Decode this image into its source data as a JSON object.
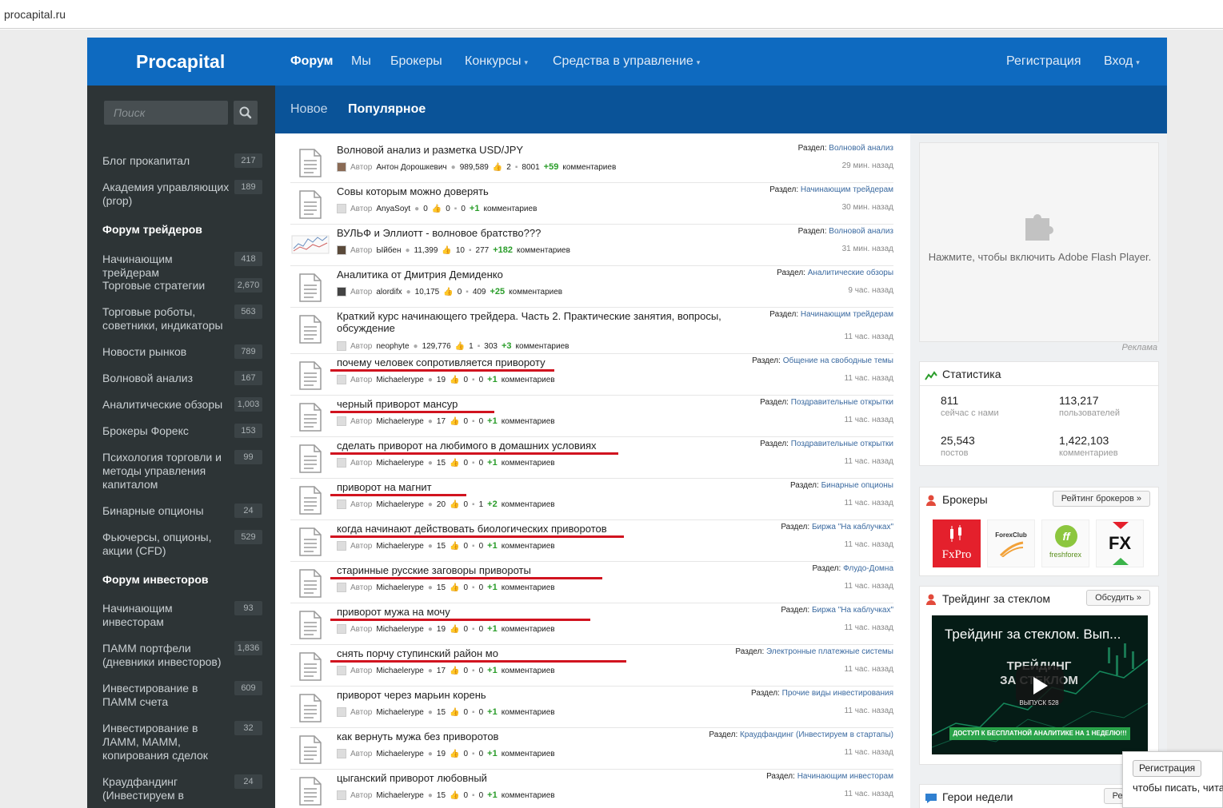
{
  "browser": {
    "url": "procapital.ru"
  },
  "header": {
    "logo": "Procapital",
    "nav": [
      {
        "label": "Форум",
        "active": true
      },
      {
        "label": "Мы"
      },
      {
        "label": "Брокеры"
      },
      {
        "label": "Конкурсы",
        "dropdown": true
      },
      {
        "label": "Средства в управление",
        "dropdown": true
      }
    ],
    "register": "Регистрация",
    "login": "Вход"
  },
  "sidebar": {
    "search_placeholder": "Поиск",
    "items": [
      {
        "label": "Блог прокапитал",
        "count": "217"
      },
      {
        "label": "Академия управляющих (prop)",
        "count": "189"
      },
      {
        "label": "Форум трейдеров",
        "heading": true
      },
      {
        "label": "Начинающим трейдерам",
        "count": "418"
      },
      {
        "label": "Торговые стратегии",
        "count": "2,670"
      },
      {
        "label": "Торговые роботы, советники, индикаторы",
        "count": "563"
      },
      {
        "label": "Новости рынков",
        "count": "789"
      },
      {
        "label": "Волновой анализ",
        "count": "167"
      },
      {
        "label": "Аналитические обзоры",
        "count": "1,003"
      },
      {
        "label": "Брокеры Форекс",
        "count": "153"
      },
      {
        "label": "Психология торговли и методы управления капиталом",
        "count": "99"
      },
      {
        "label": "Бинарные опционы",
        "count": "24"
      },
      {
        "label": "Фьючерсы, опционы, акции (CFD)",
        "count": "529"
      },
      {
        "label": "Форум инвесторов",
        "heading": true
      },
      {
        "label": "Начинающим инвесторам",
        "count": "93"
      },
      {
        "label": "ПАММ портфели (дневники инвесторов)",
        "count": "1,836"
      },
      {
        "label": "Инвестирование в ПАММ счета",
        "count": "609"
      },
      {
        "label": "Инвестирование в ЛАММ, МАММ, копирования сделок",
        "count": "32"
      },
      {
        "label": "Краудфандинг (Инвестируем в",
        "count": "24"
      }
    ]
  },
  "subnav": {
    "new": "Новое",
    "popular": "Популярное"
  },
  "posts": [
    {
      "title": "Волновой анализ и разметка USD/JPY",
      "author_label": "Автор",
      "author": "Антон Дорошкевич",
      "views": "989,589",
      "likes": "2",
      "comments": "8001",
      "plus": "+59",
      "comments_label": "комментариев",
      "section_label": "Раздел:",
      "section": "Волновой анализ",
      "time": "29 мин. назад",
      "thumb": "photo",
      "underline": false
    },
    {
      "title": "Совы которым можно доверять",
      "author_label": "Автор",
      "author": "AnyaSoyt",
      "views": "0",
      "likes": "0",
      "comments": "0",
      "plus": "+1",
      "comments_label": "комментариев",
      "section_label": "Раздел:",
      "section": "Начинающим трейдерам",
      "time": "30 мин. назад",
      "thumb": "doc",
      "underline": false
    },
    {
      "title": "ВУЛЬФ и Эллиотт - волновое братство???",
      "author_label": "Автор",
      "author": "Ыйбен",
      "views": "11,399",
      "likes": "10",
      "comments": "277",
      "plus": "+182",
      "comments_label": "комментариев",
      "section_label": "Раздел:",
      "section": "Волновой анализ",
      "time": "31 мин. назад",
      "thumb": "chart",
      "underline": false
    },
    {
      "title": "Аналитика от Дмитрия Демиденко",
      "author_label": "Автор",
      "author": "alordifx",
      "views": "10,175",
      "likes": "0",
      "comments": "409",
      "plus": "+25",
      "comments_label": "комментариев",
      "section_label": "Раздел:",
      "section": "Аналитические обзоры",
      "time": "9 час. назад",
      "thumb": "doc",
      "underline": false
    },
    {
      "title": "Краткий курс начинающего трейдера. Часть 2. Практические занятия, вопросы, обсуждение",
      "author_label": "Автор",
      "author": "neophyte",
      "views": "129,776",
      "likes": "1",
      "comments": "303",
      "plus": "+3",
      "comments_label": "комментариев",
      "section_label": "Раздел:",
      "section": "Начинающим трейдерам",
      "time": "11 час. назад",
      "thumb": "doc",
      "underline": false
    },
    {
      "title": "почему человек сопротивляется привороту",
      "author_label": "Автор",
      "author": "Michaelerype",
      "views": "19",
      "likes": "0",
      "comments": "0",
      "plus": "+1",
      "comments_label": "комментариев",
      "section_label": "Раздел:",
      "section": "Общение на свободные темы",
      "time": "11 час. назад",
      "thumb": "doc",
      "underline": true
    },
    {
      "title": "черный приворот мансур",
      "author_label": "Автор",
      "author": "Michaelerype",
      "views": "17",
      "likes": "0",
      "comments": "0",
      "plus": "+1",
      "comments_label": "комментариев",
      "section_label": "Раздел:",
      "section": "Поздравительные открытки",
      "time": "11 час. назад",
      "thumb": "doc",
      "underline": true
    },
    {
      "title": "сделать приворот на любимого в домашних условиях",
      "author_label": "Автор",
      "author": "Michaelerype",
      "views": "15",
      "likes": "0",
      "comments": "0",
      "plus": "+1",
      "comments_label": "комментариев",
      "section_label": "Раздел:",
      "section": "Поздравительные открытки",
      "time": "11 час. назад",
      "thumb": "doc",
      "underline": true
    },
    {
      "title": "приворот на магнит",
      "author_label": "Автор",
      "author": "Michaelerype",
      "views": "20",
      "likes": "0",
      "comments": "1",
      "plus": "+2",
      "comments_label": "комментариев",
      "section_label": "Раздел:",
      "section": "Бинарные опционы",
      "time": "11 час. назад",
      "thumb": "doc",
      "underline": true
    },
    {
      "title": "когда начинают действовать биологических приворотов",
      "author_label": "Автор",
      "author": "Michaelerype",
      "views": "15",
      "likes": "0",
      "comments": "0",
      "plus": "+1",
      "comments_label": "комментариев",
      "section_label": "Раздел:",
      "section": "Биржа \"На каблучках\"",
      "time": "11 час. назад",
      "thumb": "doc",
      "underline": true
    },
    {
      "title": "старинные русские заговоры привороты",
      "author_label": "Автор",
      "author": "Michaelerype",
      "views": "15",
      "likes": "0",
      "comments": "0",
      "plus": "+1",
      "comments_label": "комментариев",
      "section_label": "Раздел:",
      "section": "Флудо-Домна",
      "time": "11 час. назад",
      "thumb": "doc",
      "underline": true
    },
    {
      "title": "приворот мужа на мочу",
      "author_label": "Автор",
      "author": "Michaelerype",
      "views": "19",
      "likes": "0",
      "comments": "0",
      "plus": "+1",
      "comments_label": "комментариев",
      "section_label": "Раздел:",
      "section": "Биржа \"На каблучках\"",
      "time": "11 час. назад",
      "thumb": "doc",
      "underline": true
    },
    {
      "title": "снять порчу ступинский район мо",
      "author_label": "Автор",
      "author": "Michaelerype",
      "views": "17",
      "likes": "0",
      "comments": "0",
      "plus": "+1",
      "comments_label": "комментариев",
      "section_label": "Раздел:",
      "section": "Электронные платежные системы",
      "time": "11 час. назад",
      "thumb": "doc",
      "underline": true
    },
    {
      "title": "приворот через марьин корень",
      "author_label": "Автор",
      "author": "Michaelerype",
      "views": "15",
      "likes": "0",
      "comments": "0",
      "plus": "+1",
      "comments_label": "комментариев",
      "section_label": "Раздел:",
      "section": "Прочие виды инвестирования",
      "time": "11 час. назад",
      "thumb": "doc",
      "underline": false
    },
    {
      "title": "как вернуть мужа без приворотов",
      "author_label": "Автор",
      "author": "Michaelerype",
      "views": "19",
      "likes": "0",
      "comments": "0",
      "plus": "+1",
      "comments_label": "комментариев",
      "section_label": "Раздел:",
      "section": "Краудфандинг (Инвестируем в стартапы)",
      "time": "11 час. назад",
      "thumb": "doc",
      "underline": false
    },
    {
      "title": "цыганский приворот любовный",
      "author_label": "Автор",
      "author": "Michaelerype",
      "views": "15",
      "likes": "0",
      "comments": "0",
      "plus": "+1",
      "comments_label": "комментариев",
      "section_label": "Раздел:",
      "section": "Начинающим инвесторам",
      "time": "11 час. назад",
      "thumb": "doc",
      "underline": false
    }
  ],
  "ad": {
    "text": "Нажмите, чтобы включить Adobe Flash Player.",
    "label": "Реклама"
  },
  "stats": {
    "title": "Статистика",
    "online": "811",
    "online_label": "сейчас с нами",
    "users": "113,217",
    "users_label": "пользователей",
    "posts": "25,543",
    "posts_label": "постов",
    "comments": "1,422,103",
    "comments_label": "комментариев"
  },
  "brokers": {
    "title": "Брокеры",
    "button": "Рейтинг брокеров »",
    "logos": [
      {
        "name": "FxPro",
        "color": "#e4202c"
      },
      {
        "name": "ForexClub"
      },
      {
        "name": "freshforex",
        "color": "#8cc63e"
      },
      {
        "name": "FX"
      }
    ]
  },
  "trading": {
    "title": "Трейдинг за стеклом",
    "button": "Обсудить »",
    "video_title": "Трейдинг за стеклом. Вып...",
    "video_big": "ТРЕЙДИНГ ЗА СТЕКЛОМ",
    "video_small": "ВЫПУСК 528",
    "video_banner": "ДОСТУП К БЕСПЛАТНОЙ АНАЛИТИКЕ НА 1 НЕДЕЛЮ!!!"
  },
  "heroes": {
    "title": "Герои недели",
    "button": "Рейтин"
  },
  "popup": {
    "button": "Регистрация",
    "text": "чтобы писать, чита"
  },
  "colors": {
    "nav": "#0e6ac0",
    "subnav": "#0a5398",
    "sidebar": "#2d3436",
    "underline": "#d1131f",
    "plus": "#2a9d2a"
  }
}
